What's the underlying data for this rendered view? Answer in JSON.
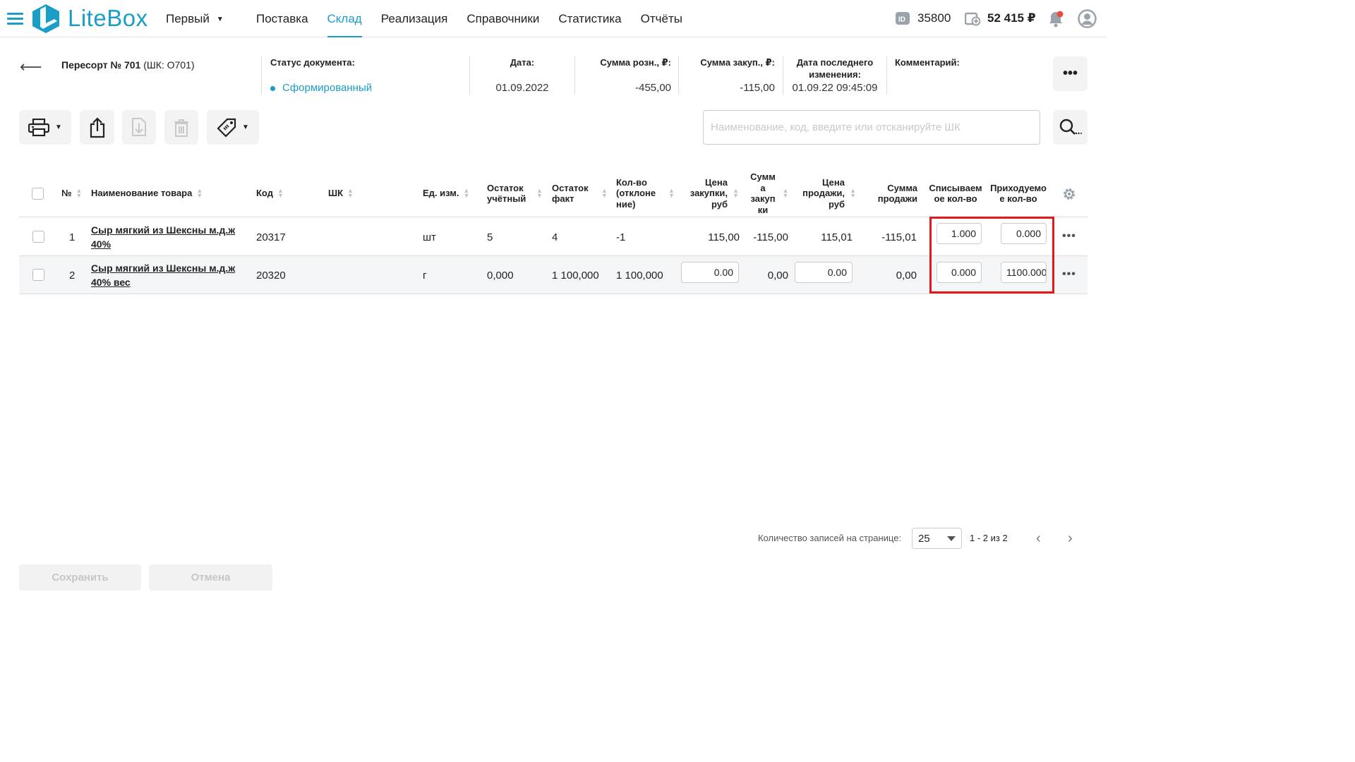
{
  "nav": {
    "logo_text": "LiteBox",
    "store": "Первый",
    "menu": [
      "Поставка",
      "Склад",
      "Реализация",
      "Справочники",
      "Статистика",
      "Отчёты"
    ],
    "active_menu": "Склад",
    "account_id": "35800",
    "balance": "52 415 ₽"
  },
  "doc": {
    "title_prefix": "Пересорт № 701",
    "title_suffix": " (ШК: O701)",
    "status_label": "Статус документа:",
    "status_value": "Сформированный",
    "date_label": "Дата:",
    "date_value": "01.09.2022",
    "retail_sum_label": "Сумма розн., ₽:",
    "retail_sum_value": "-455,00",
    "purchase_sum_label": "Сумма закуп., ₽:",
    "purchase_sum_value": "-115,00",
    "last_change_label": "Дата последнего изменения:",
    "last_change_value": "01.09.22 09:45:09",
    "comment_label": "Комментарий:",
    "comment_value": ""
  },
  "search": {
    "placeholder": "Наименование, код, введите или отсканируйте ШК"
  },
  "table": {
    "headers": {
      "num": "№",
      "name": "Наименование товара",
      "code": "Код",
      "barcode": "ШК",
      "unit": "Ед. изм.",
      "stock_acc": "Остаток учётный",
      "stock_fact": "Остаток факт",
      "qty_dev": "Кол-во (отклоне ние)",
      "buy_price": "Цена закупки, руб",
      "buy_sum": "Сумм а закуп ки",
      "sell_price": "Цена продажи, руб",
      "sell_sum": "Сумма продажи",
      "writeoff": "Списываем ое кол-во",
      "incoming": "Приходуемо е кол-во"
    },
    "rows": [
      {
        "num": "1",
        "name": "Сыр мягкий из Шексны м.д.ж 40%",
        "code": "20317",
        "barcode": "",
        "unit": "шт",
        "stock_acc": "5",
        "stock_fact": "4",
        "qty_dev": "-1",
        "buy_price": "115,00",
        "buy_sum": "-115,00",
        "sell_price": "115,01",
        "sell_sum": "-115,01",
        "writeoff": "1.000",
        "incoming": "0.000"
      },
      {
        "num": "2",
        "name": "Сыр мягкий из Шексны м.д.ж 40% вес",
        "code": "20320",
        "barcode": "",
        "unit": "г",
        "stock_acc": "0,000",
        "stock_fact": "1 100,000",
        "qty_dev": "1 100,000",
        "buy_price": "0.00",
        "buy_sum": "0,00",
        "sell_price": "0.00",
        "sell_sum": "0,00",
        "writeoff": "0.000",
        "incoming": "1100.000"
      }
    ]
  },
  "pagination": {
    "label": "Количество записей на странице:",
    "page_size": "25",
    "range": "1 - 2 из 2"
  },
  "footer": {
    "save": "Сохранить",
    "cancel": "Отмена"
  },
  "colors": {
    "accent": "#1a9dc6",
    "highlight": "#e5161c"
  }
}
